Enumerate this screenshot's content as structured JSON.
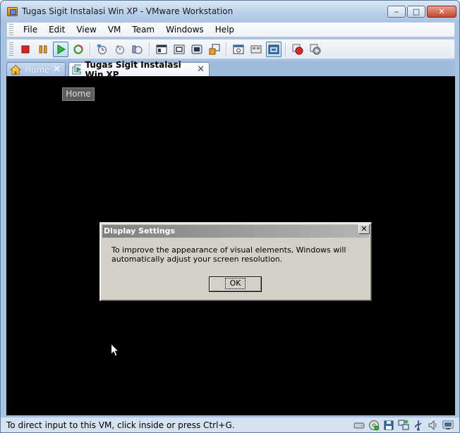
{
  "window": {
    "title": "Tugas Sigit Instalasi Win XP - VMware Workstation",
    "minimize_label": "‒",
    "maximize_label": "□",
    "close_label": "✕"
  },
  "menu": {
    "items": [
      "File",
      "Edit",
      "View",
      "VM",
      "Team",
      "Windows",
      "Help"
    ]
  },
  "toolbar": {
    "icons": [
      "power-off-icon",
      "suspend-icon",
      "power-on-icon",
      "reset-icon",
      "take-snapshot-icon",
      "revert-snapshot-icon",
      "snapshot-manager-icon",
      "quick-switch-icon",
      "full-screen-icon",
      "unity-icon",
      "unity-menu-icon",
      "console-view-icon",
      "thumbnail-icon",
      "summary-view-icon",
      "record-icon",
      "replay-icon"
    ]
  },
  "tabs": {
    "home_label": "Home",
    "vm_label": "Tugas Sigit Instalasi Win XP",
    "close_glyph": "✕"
  },
  "console": {
    "home_chip": "Home"
  },
  "dialog": {
    "title": "Display Settings",
    "close_glyph": "✕",
    "message": "To improve the appearance of visual elements, Windows will automatically adjust your screen resolution.",
    "ok_label": "OK"
  },
  "status": {
    "text": "To direct input to this VM, click inside or press Ctrl+G."
  },
  "colors": {
    "frame": "#a9c4e3",
    "console_bg": "#000000",
    "dialog_bg": "#d4d0c8",
    "dialog_title": "#808080"
  }
}
